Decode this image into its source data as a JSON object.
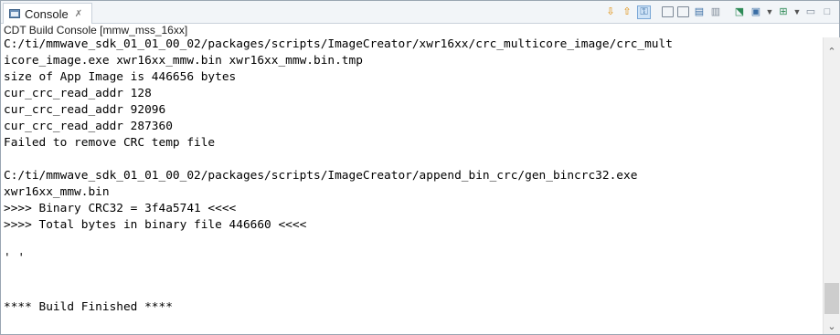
{
  "tab": {
    "label": "Console",
    "close": "✗"
  },
  "toolbar": {
    "icons": [
      "scroll-down-icon",
      "scroll-up-icon",
      "scroll-lock-icon",
      "copy-icon",
      "paste-icon",
      "select-all-icon",
      "clear-icon",
      "pin-icon",
      "display-console-icon",
      "open-console-icon",
      "minimize-icon",
      "maximize-icon"
    ]
  },
  "console": {
    "title": "CDT Build Console [mmw_mss_16xx]",
    "lines": [
      "C:/ti/mmwave_sdk_01_01_00_02/packages/scripts/ImageCreator/xwr16xx/crc_multicore_image/crc_mult",
      "icore_image.exe xwr16xx_mmw.bin xwr16xx_mmw.bin.tmp",
      "size of App Image is 446656 bytes",
      "cur_crc_read_addr 128",
      "cur_crc_read_addr 92096",
      "cur_crc_read_addr 287360",
      "Failed to remove CRC temp file",
      "",
      "C:/ti/mmwave_sdk_01_01_00_02/packages/scripts/ImageCreator/append_bin_crc/gen_bincrc32.exe",
      "xwr16xx_mmw.bin",
      ">>>> Binary CRC32 = 3f4a5741 <<<<",
      ">>>> Total bytes in binary file 446660 <<<<",
      "",
      "' '",
      "",
      "",
      "**** Build Finished ****"
    ]
  },
  "colors": {
    "accent": "#3a6ea5",
    "border": "#9aa6b2",
    "tab_bg": "#f2f5f8"
  }
}
